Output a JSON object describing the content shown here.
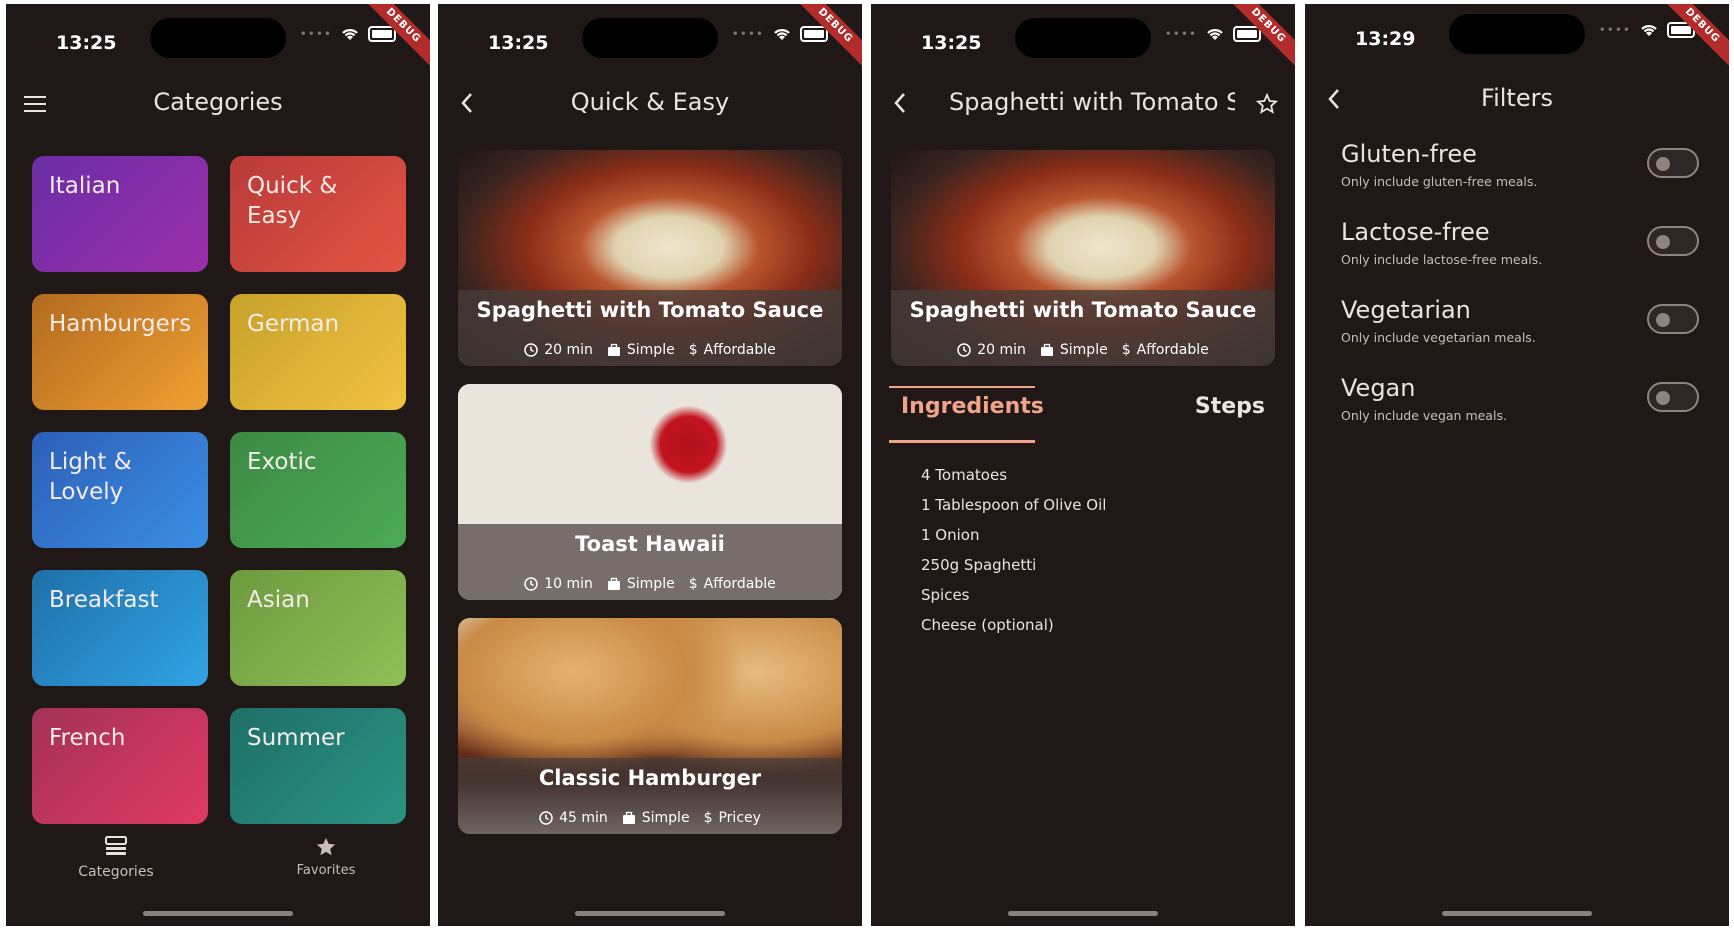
{
  "status": {
    "time_1": "13:25",
    "time_2": "13:25",
    "time_3": "13:25",
    "time_4": "13:29",
    "debug": "DEBUG"
  },
  "categories_screen": {
    "title": "Categories",
    "tiles": [
      {
        "label": "Italian",
        "colors": [
          "#6a2ea6",
          "#9b2fa9"
        ]
      },
      {
        "label": "Quick & Easy",
        "colors": [
          "#b93a3a",
          "#e35442"
        ]
      },
      {
        "label": "Hamburgers",
        "colors": [
          "#b26a1f",
          "#f0a033"
        ]
      },
      {
        "label": "German",
        "colors": [
          "#c7a12b",
          "#f1c242"
        ]
      },
      {
        "label": "Light & Lovely",
        "colors": [
          "#2d5fb8",
          "#3b8fe4"
        ]
      },
      {
        "label": "Exotic",
        "colors": [
          "#3c8a45",
          "#4caa55"
        ]
      },
      {
        "label": "Breakfast",
        "colors": [
          "#1f6fa8",
          "#31a4e5"
        ]
      },
      {
        "label": "Asian",
        "colors": [
          "#6e9a3f",
          "#90bf57"
        ]
      },
      {
        "label": "French",
        "colors": [
          "#a33158",
          "#e03a63"
        ]
      },
      {
        "label": "Summer",
        "colors": [
          "#1f6e67",
          "#2a9384"
        ]
      }
    ],
    "nav": {
      "categories": "Categories",
      "favorites": "Favorites"
    }
  },
  "meals_screen": {
    "title": "Quick & Easy",
    "meals": [
      {
        "title": "Spaghetti with Tomato Sauce",
        "duration": "20 min",
        "complexity": "Simple",
        "affordability": "Affordable"
      },
      {
        "title": "Toast Hawaii",
        "duration": "10 min",
        "complexity": "Simple",
        "affordability": "Affordable"
      },
      {
        "title": "Classic Hamburger",
        "duration": "45 min",
        "complexity": "Simple",
        "affordability": "Pricey"
      }
    ]
  },
  "detail_screen": {
    "title": "Spaghetti with Tomato S...",
    "meal": {
      "title": "Spaghetti with Tomato Sauce",
      "duration": "20 min",
      "complexity": "Simple",
      "affordability": "Affordable"
    },
    "tabs": {
      "ingredients": "Ingredients",
      "steps": "Steps"
    },
    "ingredients": [
      "4 Tomatoes",
      "1 Tablespoon of Olive Oil",
      "1 Onion",
      "250g Spaghetti",
      "Spices",
      "Cheese (optional)"
    ]
  },
  "filters_screen": {
    "title": "Filters",
    "filters": [
      {
        "title": "Gluten-free",
        "subtitle": "Only include gluten-free meals.",
        "enabled": false
      },
      {
        "title": "Lactose-free",
        "subtitle": "Only include lactose-free meals.",
        "enabled": false
      },
      {
        "title": "Vegetarian",
        "subtitle": "Only include vegetarian meals.",
        "enabled": false
      },
      {
        "title": "Vegan",
        "subtitle": "Only include vegan meals.",
        "enabled": false
      }
    ]
  },
  "colors": {
    "background": "#1f1817",
    "accent": "#f0a588",
    "text": "#ece2df"
  }
}
